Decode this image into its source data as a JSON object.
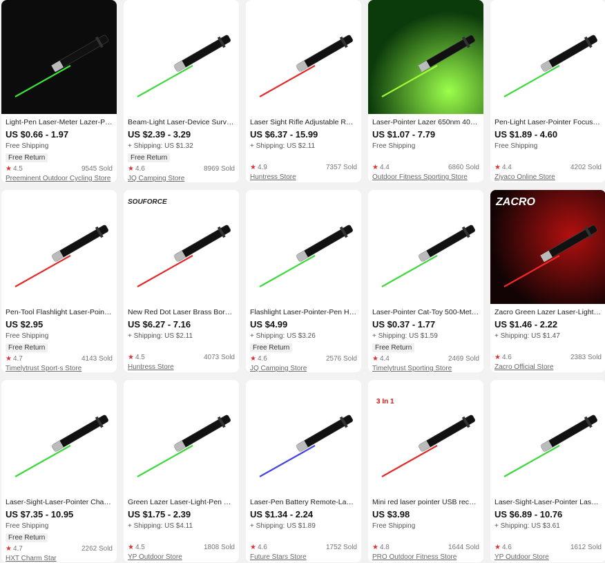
{
  "ship_label": "Free Shipping",
  "free_return_label": "Free Return",
  "products": [
    {
      "title": "Light-Pen Laser-Meter Lazer-Point...",
      "price": "US $0.66 - 1.97",
      "shipping": "Free Shipping",
      "free_return": "Free Return",
      "rating": "4.5",
      "sold": "9545 Sold",
      "store": "Preeminent Outdoor Cycling Store",
      "theme": "dark",
      "beam": "#3cf23c"
    },
    {
      "title": "Beam-Light Laser-Device Survival-...",
      "price": "US $2.39 - 3.29",
      "shipping": "+ Shipping: US $1.32",
      "free_return": "Free Return",
      "rating": "4.6",
      "sold": "8969 Sold",
      "store": "JQ Camping Store",
      "theme": "light",
      "beam": "#33d633"
    },
    {
      "title": "Laser Sight Rifle Adjustable Red Do...",
      "price": "US $6.37 - 15.99",
      "shipping": "+ Shipping: US $2.11",
      "free_return": "",
      "rating": "4.9",
      "sold": "7357 Sold",
      "store": "Huntress Store",
      "theme": "light",
      "beam": "#e02020"
    },
    {
      "title": "Laser-Pointer Lazer 650nm 405nm...",
      "price": "US $1.07 - 7.79",
      "shipping": "Free Shipping",
      "free_return": "",
      "rating": "4.4",
      "sold": "6860 Sold",
      "store": "Outdoor Fitness Sporting Store",
      "theme": "green",
      "beam": "#a9ff3a"
    },
    {
      "title": "Pen-Light Laser-Pointer Focus-Laz...",
      "price": "US $1.89 - 4.60",
      "shipping": "Free Shipping",
      "free_return": "",
      "rating": "4.4",
      "sold": "4202 Sold",
      "store": "Ziyaco Online Store",
      "theme": "light",
      "beam": "#33d633"
    },
    {
      "title": "Pen-Tool Flashlight Laser-Pointer-...",
      "price": "US $2.95",
      "shipping": "Free Shipping",
      "free_return": "Free Return",
      "rating": "4.7",
      "sold": "4143 Sold",
      "store": "Timelytrust Sport-s Store",
      "theme": "light",
      "beam": "#e02020"
    },
    {
      "title": "New Red Dot Laser Brass Boresigh...",
      "price": "US $6.27 - 7.16",
      "shipping": "+ Shipping: US $2.11",
      "free_return": "",
      "rating": "4.5",
      "sold": "4073 Sold",
      "store": "Huntress Store",
      "theme": "light",
      "beam": "#e02020"
    },
    {
      "title": "Flashlight Laser-Pointer-Pen Hunti...",
      "price": "US $4.99",
      "shipping": "+ Shipping: US $3.26",
      "free_return": "Free Return",
      "rating": "4.6",
      "sold": "2576 Sold",
      "store": "JQ Camping Store",
      "theme": "light",
      "beam": "#33d633"
    },
    {
      "title": "Laser-Pointer Cat-Toy 500-Meters ...",
      "price": "US $0.37 - 1.77",
      "shipping": "+ Shipping: US $1.59",
      "free_return": "Free Return",
      "rating": "4.4",
      "sold": "2469 Sold",
      "store": "Timelytrust Sporting Store",
      "theme": "light",
      "beam": "#33d633"
    },
    {
      "title": "Zacro Green Lazer Laser-Light-Pen...",
      "price": "US $1.46 - 2.22",
      "shipping": "+ Shipping: US $1.47",
      "free_return": "",
      "rating": "4.6",
      "sold": "2383 Sold",
      "store": "Zacro Official Store",
      "theme": "red",
      "beam": "#ff2a2a",
      "logo": "ZACRO"
    },
    {
      "title": "Laser-Sight-Laser-Pointer Charger ...",
      "price": "US $7.35 - 10.95",
      "shipping": "Free Shipping",
      "free_return": "Free Return",
      "rating": "4.7",
      "sold": "2262 Sold",
      "store": "HXT Charm Star",
      "theme": "light",
      "beam": "#33d633"
    },
    {
      "title": "Green Lazer Laser-Light-Pen Laser...",
      "price": "US $1.75 - 2.39",
      "shipping": "+ Shipping: US $4.11",
      "free_return": "",
      "rating": "4.5",
      "sold": "1808 Sold",
      "store": "YP Outdoor Store",
      "theme": "light",
      "beam": "#33d633"
    },
    {
      "title": "Laser-Pen Battery Remote-Lazer P...",
      "price": "US $1.34 - 2.24",
      "shipping": "+ Shipping: US $1.89",
      "free_return": "",
      "rating": "4.6",
      "sold": "1752 Sold",
      "store": "Future Stars Store",
      "theme": "light",
      "beam": "#3a3ae0"
    },
    {
      "title": "Mini red laser pointer USB recharg...",
      "price": "US $3.98",
      "shipping": "Free Shipping",
      "free_return": "",
      "rating": "4.8",
      "sold": "1644 Sold",
      "store": "PRO Outdoor Fitness Store",
      "theme": "light",
      "beam": "#e02020",
      "badge": "3 In 1"
    },
    {
      "title": "Laser-Sight-Laser-Pointer Laser-Pe...",
      "price": "US $6.89 - 10.76",
      "shipping": "+ Shipping: US $3.61",
      "free_return": "",
      "rating": "4.6",
      "sold": "1612 Sold",
      "store": "YP Outdoor Store",
      "theme": "light",
      "beam": "#33d633"
    }
  ],
  "brand_text_2": "SOUFORCE"
}
